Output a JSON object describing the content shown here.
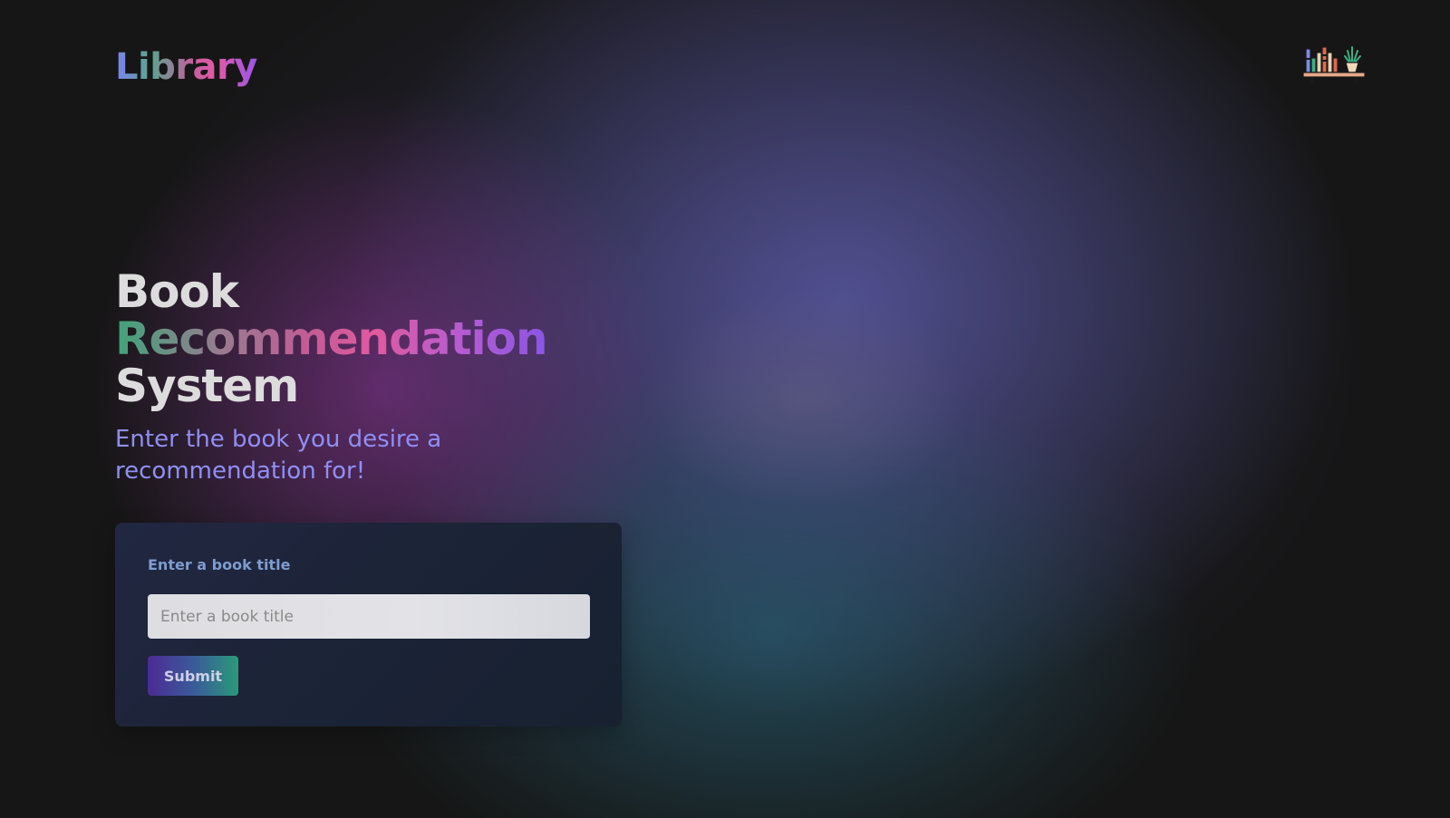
{
  "header": {
    "logo_text": "Library",
    "shelf_icon": "bookshelf-plant-icon"
  },
  "hero": {
    "title_line1": "Book",
    "title_line2": "Recommendation",
    "title_line3": "System",
    "subtitle": "Enter the book you desire a recommendation for!"
  },
  "form": {
    "label": "Enter a book title",
    "input_value": "",
    "input_placeholder": "Enter a book title",
    "submit_label": "Submit"
  },
  "colors": {
    "background": "#161616",
    "subtitle": "#8f8ff4",
    "card_label": "#7d9ccf",
    "accent_purple": "#4d2a95",
    "accent_green": "#2a9a78"
  }
}
